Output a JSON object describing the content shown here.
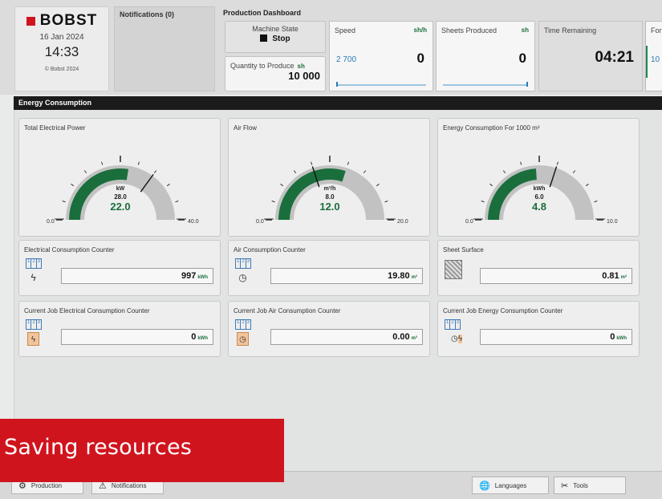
{
  "brand": {
    "logo": "BOBST",
    "date": "16 Jan 2024",
    "time": "14:33",
    "copyright": "© Bobst 2024"
  },
  "notifications": {
    "label": "Notifications (0)"
  },
  "dashboard": {
    "title": "Production Dashboard",
    "machine_state": {
      "label": "Machine State",
      "value": "Stop"
    },
    "quantity": {
      "label": "Quantity to Produce",
      "unit": "sh",
      "value": "10 000"
    },
    "speed": {
      "label": "Speed",
      "unit": "sh/h",
      "value": "0",
      "set_value": "2 700"
    },
    "sheets": {
      "label": "Sheets Produced",
      "unit": "sh",
      "value": "0"
    },
    "time_remaining": {
      "label": "Time Remaining",
      "value": "04:21"
    },
    "forn": {
      "label": "For",
      "value": "10"
    }
  },
  "section": {
    "title": "Energy Consumption"
  },
  "gauges": [
    {
      "label": "Total Electrical Power",
      "unit": "kW",
      "marker": "28.0",
      "value": "22.0",
      "min": "0.0",
      "max": "40.0",
      "fill": 0.55,
      "marker_frac": 0.7
    },
    {
      "label": "Air Flow",
      "unit": "m³/h",
      "marker": "8.0",
      "value": "12.0",
      "min": "0.0",
      "max": "20.0",
      "fill": 0.6,
      "marker_frac": 0.4
    },
    {
      "label": "Energy Consumption For 1000 m²",
      "unit": "kWh",
      "marker": "6.0",
      "value": "4.8",
      "min": "0.0",
      "max": "10.0",
      "fill": 0.48,
      "marker_frac": 0.6
    }
  ],
  "counters": [
    {
      "label": "Electrical Consumption Counter",
      "value": "997",
      "unit": "kWh",
      "icon": "lightning-icon"
    },
    {
      "label": "Air Consumption Counter",
      "value": "19.80",
      "unit": "m³",
      "icon": "gauge-icon"
    },
    {
      "label": "Sheet Surface",
      "value": "0.81",
      "unit": "m²",
      "icon": "sheet-icon"
    },
    {
      "label": "Current Job Electrical Consumption Counter",
      "value": "0",
      "unit": "kWh",
      "icon": "lightning-icon"
    },
    {
      "label": "Current Job Air Consumption Counter",
      "value": "0.00",
      "unit": "m³",
      "icon": "gauge-icon"
    },
    {
      "label": "Current Job Energy Consumption Counter",
      "value": "0",
      "unit": "kWh",
      "icon": "energy-icon"
    }
  ],
  "counter_icon_digits": [
    "1",
    "2",
    "3"
  ],
  "bottom": {
    "production": "Production",
    "notifications": "Notifications",
    "languages": "Languages",
    "tools": "Tools"
  },
  "overlay": {
    "text": "Saving resources"
  },
  "colors": {
    "accent_red": "#d0141e",
    "gauge_green": "#1a6e3c",
    "gauge_grey": "#c2c2c2",
    "link_blue": "#2a7ab8"
  }
}
